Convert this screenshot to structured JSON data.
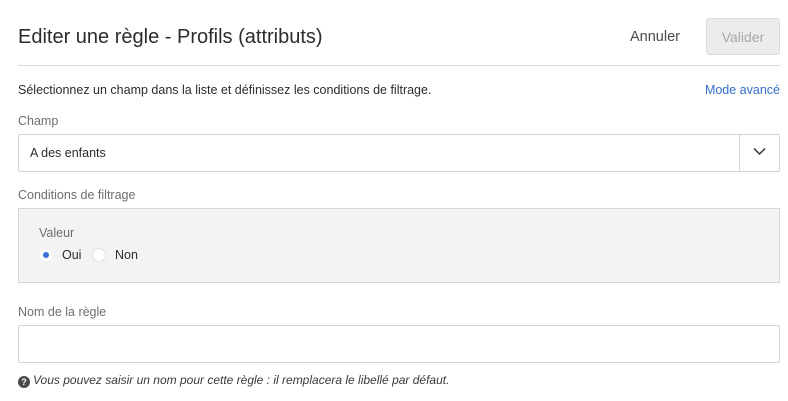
{
  "dialog": {
    "title": "Editer une règle - Profils (attributs)",
    "cancel_label": "Annuler",
    "validate_label": "Valider",
    "instructions": "Sélectionnez un champ dans la liste et définissez les conditions de filtrage.",
    "advanced_mode_label": "Mode avancé"
  },
  "field": {
    "label": "Champ",
    "selected_value": "A des enfants",
    "dropdown_icon": "chevron-down-icon"
  },
  "filter": {
    "label": "Conditions de filtrage",
    "value_label": "Valeur",
    "options": [
      {
        "label": "Oui",
        "checked": true
      },
      {
        "label": "Non",
        "checked": false
      }
    ]
  },
  "rule_name": {
    "label": "Nom de la règle",
    "value": "",
    "hint_icon": "help-icon",
    "hint_glyph": "?",
    "hint": "Vous pouvez saisir un nom pour cette règle : il remplacera le libellé par défaut."
  },
  "colors": {
    "link": "#326ec8",
    "radio_selected": "#3d6fd6",
    "disabled_button_bg": "#ececec",
    "panel_bg": "#f3f3f3"
  }
}
